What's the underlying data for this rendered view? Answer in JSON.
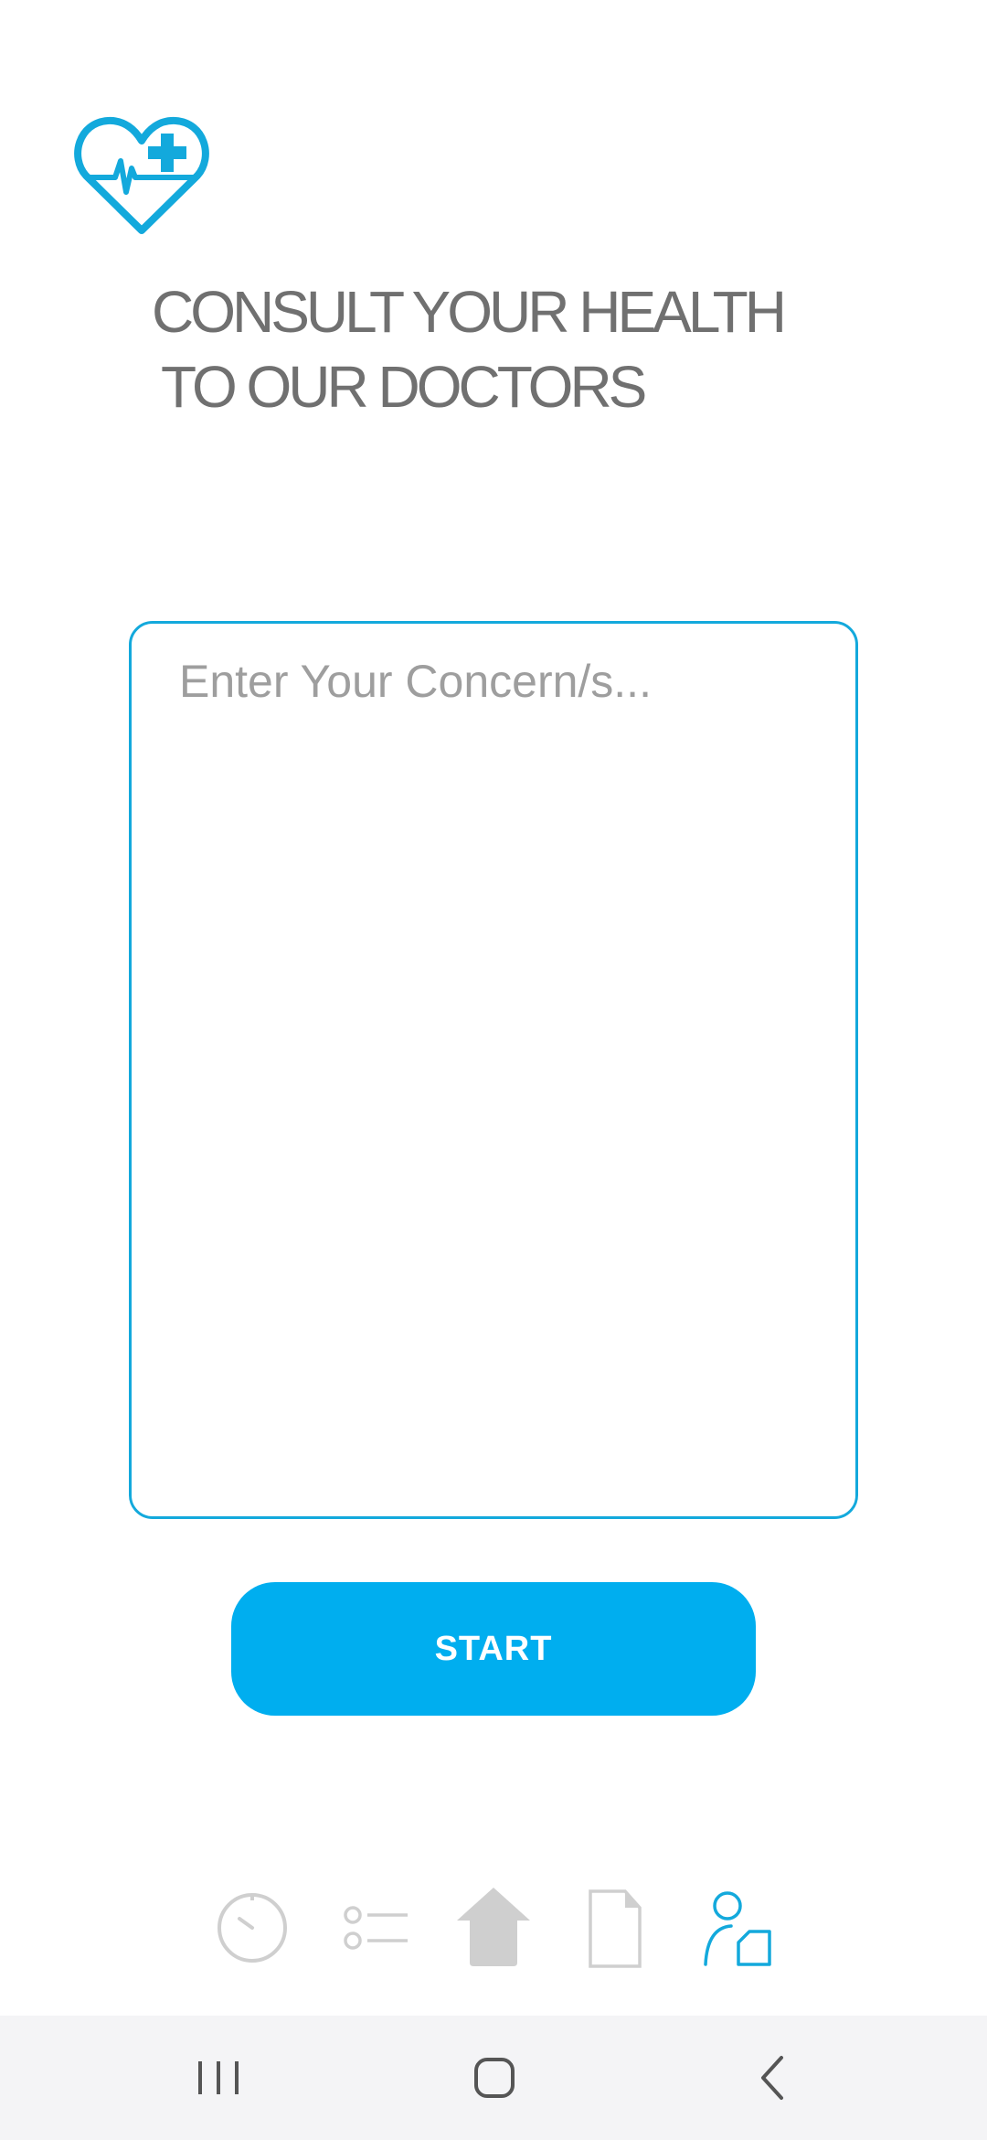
{
  "colors": {
    "accent": "#00aeef",
    "border": "#13a9dc",
    "headline": "#707070",
    "nav_inactive": "#cfcfcf",
    "nav_active": "#13a9dc",
    "system_bar": "#f4f4f6"
  },
  "header": {
    "logo_icon": "heart-cross-pulse-icon",
    "headline_line1": "CONSULT YOUR HEALTH",
    "headline_line2": "TO OUR DOCTORS"
  },
  "form": {
    "concern_placeholder": "Enter Your Concern/s...",
    "concern_value": "",
    "start_label": "START"
  },
  "bottom_nav": {
    "items": [
      {
        "icon": "history-clock-icon",
        "active": false
      },
      {
        "icon": "list-icon",
        "active": false
      },
      {
        "icon": "home-icon",
        "active": false
      },
      {
        "icon": "document-icon",
        "active": false
      },
      {
        "icon": "profile-icon",
        "active": true
      }
    ]
  },
  "system_nav": {
    "items": [
      "recents-icon",
      "home-circle-icon",
      "back-icon"
    ]
  }
}
